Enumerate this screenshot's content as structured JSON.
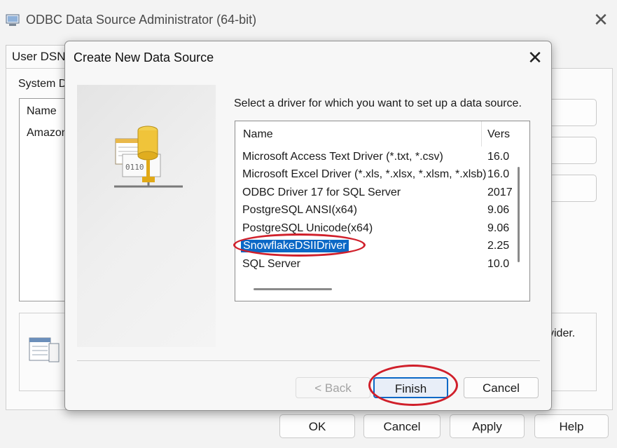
{
  "background_window": {
    "title": "ODBC Data Source Administrator (64-bit)",
    "close_symbol": "✕",
    "tab_user_dsn": "User DSN",
    "system_label": "System D",
    "list_header": "Name",
    "list_item": "Amazon",
    "info_text": "vider.",
    "buttons": {
      "ok": "OK",
      "cancel": "Cancel",
      "apply": "Apply",
      "help": "Help"
    }
  },
  "dialog": {
    "title": "Create New Data Source",
    "close_symbol": "✕",
    "instruction": "Select a driver for which you want to set up a data source.",
    "columns": {
      "name": "Name",
      "version": "Vers"
    },
    "drivers": [
      {
        "name": "Microsoft Access Text Driver (*.txt, *.csv)",
        "version": "16.0"
      },
      {
        "name": "Microsoft Excel Driver (*.xls, *.xlsx, *.xlsm, *.xlsb)",
        "version": "16.0"
      },
      {
        "name": "ODBC Driver 17 for SQL Server",
        "version": "2017"
      },
      {
        "name": "PostgreSQL ANSI(x64)",
        "version": "9.06"
      },
      {
        "name": "PostgreSQL Unicode(x64)",
        "version": "9.06"
      },
      {
        "name": "SnowflakeDSIIDriver",
        "version": "2.25"
      },
      {
        "name": "SQL Server",
        "version": "10.0"
      }
    ],
    "selected_driver": "SnowflakeDSIIDriver",
    "buttons": {
      "back": "< Back",
      "finish": "Finish",
      "cancel": "Cancel"
    }
  },
  "colors": {
    "selection": "#0b68c6",
    "annotation": "#d01f2a"
  },
  "icons": [
    "odbc-app-icon",
    "close-icon",
    "database-driver-icon",
    "data-source-info-icon"
  ]
}
